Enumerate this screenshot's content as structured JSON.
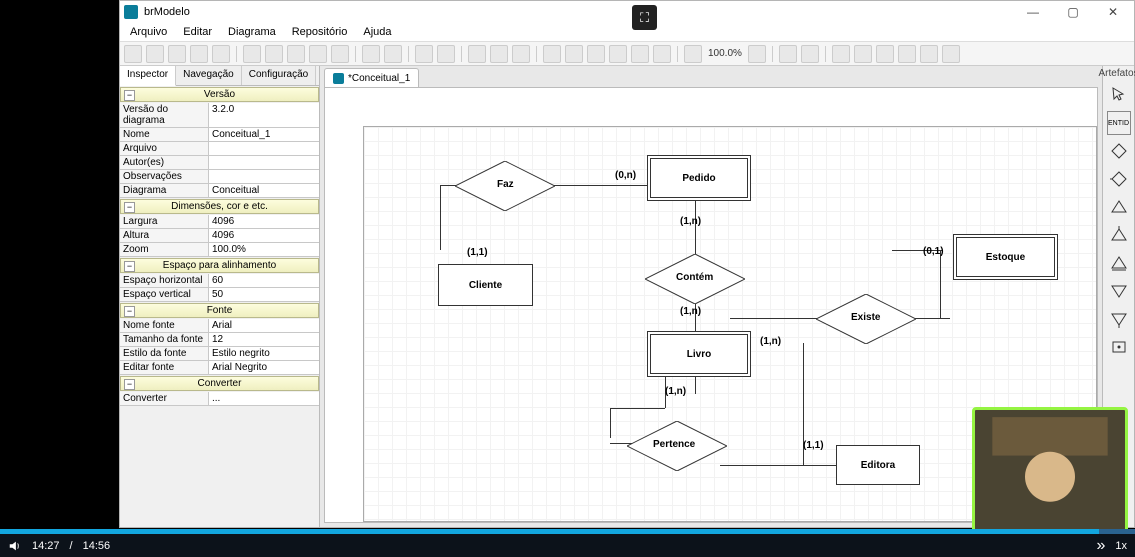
{
  "window": {
    "title": "brModelo"
  },
  "menu": [
    "Arquivo",
    "Editar",
    "Diagrama",
    "Repositório",
    "Ajuda"
  ],
  "toolbar": {
    "zoom": "100.0%"
  },
  "leftTabs": {
    "t0": "Inspector",
    "t1": "Navegação",
    "t2": "Configuração"
  },
  "props": {
    "sec_versao": "Versão",
    "versao_diagrama_k": "Versão do diagrama",
    "versao_diagrama_v": "3.2.0",
    "nome_k": "Nome",
    "nome_v": "Conceitual_1",
    "arquivo_k": "Arquivo",
    "arquivo_v": "",
    "autores_k": "Autor(es)",
    "autores_v": "",
    "obs_k": "Observações",
    "obs_v": "",
    "diagrama_k": "Diagrama",
    "diagrama_v": "Conceitual",
    "sec_dim": "Dimensões, cor e etc.",
    "largura_k": "Largura",
    "largura_v": "4096",
    "altura_k": "Altura",
    "altura_v": "4096",
    "zoom_k": "Zoom",
    "zoom_v": "100.0%",
    "sec_esp": "Espaço para alinhamento",
    "esp_h_k": "Espaço horizontal",
    "esp_h_v": "60",
    "esp_v_k": "Espaço vertical",
    "esp_v_v": "50",
    "sec_fonte": "Fonte",
    "nome_fonte_k": "Nome fonte",
    "nome_fonte_v": "Arial",
    "tam_fonte_k": "Tamanho da fonte",
    "tam_fonte_v": "12",
    "estilo_fonte_k": "Estilo da fonte",
    "estilo_fonte_v": "Estilo negrito",
    "editar_fonte_k": "Editar fonte",
    "editar_fonte_v": "Arial Negrito",
    "sec_conv": "Converter",
    "converter_k": "Converter",
    "converter_v": "..."
  },
  "docTab": "*Conceitual_1",
  "diagram": {
    "entities": {
      "cliente": "Cliente",
      "pedido": "Pedido",
      "livro": "Livro",
      "estoque": "Estoque",
      "editora": "Editora"
    },
    "relationships": {
      "faz": "Faz",
      "contem": "Contém",
      "existe": "Existe",
      "pertence": "Pertence"
    },
    "cards": {
      "c1": "(0,n)",
      "c2": "(1,1)",
      "c3": "(1,n)",
      "c4": "(1,n)",
      "c5": "(1,n)",
      "c6": "(0,1)",
      "c7": "(1,n)",
      "c8": "(1,1)"
    }
  },
  "rightPanel": {
    "header": "Artefatos"
  },
  "video": {
    "current": "14:27",
    "total": "14:56",
    "speed": "1x",
    "progress_pct": 96.8
  }
}
